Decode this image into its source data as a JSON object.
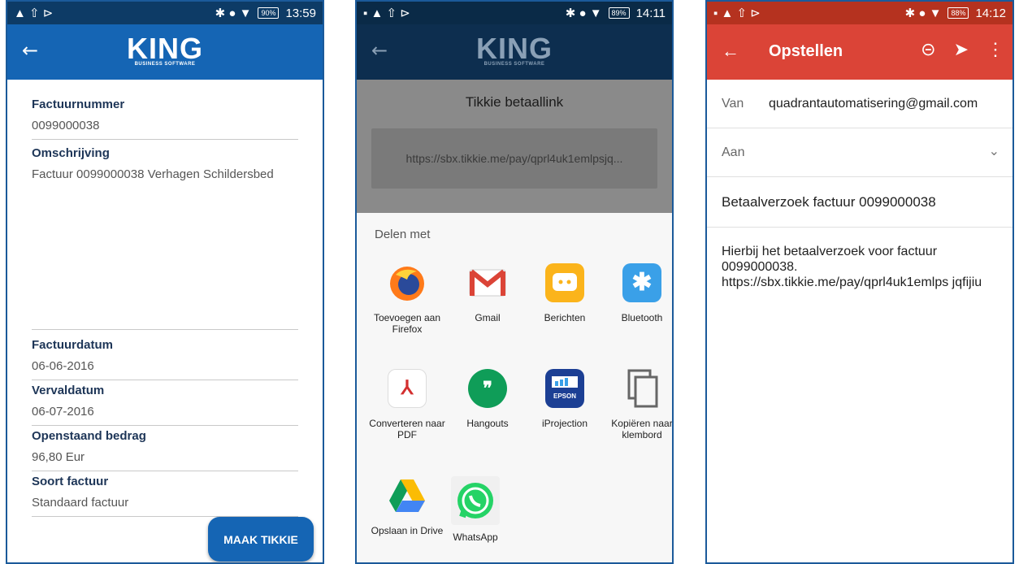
{
  "panel1": {
    "status": {
      "left_icons": "▲ ⇧ ⊳",
      "right_icons": "✱ ● ▼",
      "battery": "90%",
      "time": "13:59"
    },
    "app_logo": "KING",
    "app_logo_sub": "BUSINESS SOFTWARE",
    "fields": [
      {
        "label": "Factuurnummer",
        "value": "0099000038"
      },
      {
        "label": "Omschrijving",
        "value": "Factuur 0099000038 Verhagen Schildersbed"
      },
      {
        "label": "Factuurdatum",
        "value": "06-06-2016"
      },
      {
        "label": "Vervaldatum",
        "value": "06-07-2016"
      },
      {
        "label": "Openstaand bedrag",
        "value": "96,80 Eur"
      },
      {
        "label": "Soort factuur",
        "value": "Standaard factuur"
      }
    ],
    "button": "MAAK TIKKIE"
  },
  "panel2": {
    "status": {
      "left_icons": "▪ ▲ ⇧ ⊳",
      "right_icons": "✱ ● ▼",
      "battery": "89%",
      "time": "14:11"
    },
    "dialog_title": "Tikkie betaallink",
    "link": "https://sbx.tikkie.me/pay/qprl4uk1emlpsjq...",
    "share_header": "Delen met",
    "apps": [
      {
        "label": "Toevoegen aan Firefox",
        "icon": "firefox-icon"
      },
      {
        "label": "Gmail",
        "icon": "gmail-icon"
      },
      {
        "label": "Berichten",
        "icon": "messages-icon"
      },
      {
        "label": "Bluetooth",
        "icon": "bluetooth-icon"
      },
      {
        "label": "Converteren naar PDF",
        "icon": "pdf-icon"
      },
      {
        "label": "Hangouts",
        "icon": "hangouts-icon"
      },
      {
        "label": "iProjection",
        "icon": "epson-icon"
      },
      {
        "label": "Kopiëren naar klembord",
        "icon": "copy-icon"
      },
      {
        "label": "Opslaan in Drive",
        "icon": "drive-icon"
      },
      {
        "label": "WhatsApp",
        "icon": "whatsapp-icon"
      }
    ],
    "epson_text": "EPSON"
  },
  "panel3": {
    "status": {
      "left_icons": "▪ ▲ ⇧ ⊳",
      "right_icons": "✱ ● ▼",
      "battery": "88%",
      "time": "14:12"
    },
    "title": "Opstellen",
    "from_label": "Van",
    "from_value": "quadrantautomatisering@gmail.com",
    "to_label": "Aan",
    "subject": "Betaalverzoek factuur 0099000038",
    "body_line1": "Hierbij het betaalverzoek voor factuur 0099000038.",
    "body_line2": "https://sbx.tikkie.me/pay/qprl4uk1emlps jqfijiu"
  },
  "colors": {
    "king_blue": "#1565b4",
    "gmail_red": "#db4437"
  }
}
